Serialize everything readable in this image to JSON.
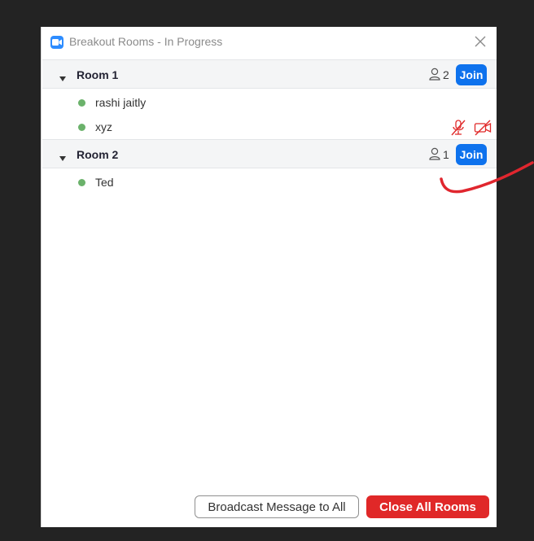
{
  "window": {
    "title": "Breakout Rooms - In Progress",
    "app_icon": "zoom-camera-icon",
    "close_icon": "close-icon"
  },
  "rooms": [
    {
      "name": "Room 1",
      "count": "2",
      "join_label": "Join",
      "participants": [
        {
          "name": "rashi jaitly",
          "status": "online",
          "muted": false,
          "video_off": false
        },
        {
          "name": "xyz",
          "status": "online",
          "muted": true,
          "video_off": true
        }
      ]
    },
    {
      "name": "Room 2",
      "count": "1",
      "join_label": "Join",
      "participants": [
        {
          "name": "Ted",
          "status": "online",
          "muted": false,
          "video_off": false
        }
      ]
    }
  ],
  "footer": {
    "broadcast_label": "Broadcast Message to All",
    "close_all_label": "Close All Rooms"
  },
  "colors": {
    "accent": "#0e72ed",
    "danger": "#e02828",
    "online": "#6bb26b",
    "annotation": "#e0262e"
  }
}
